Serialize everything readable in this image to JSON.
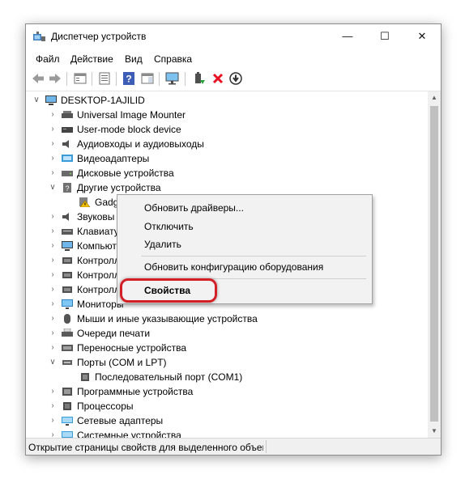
{
  "window": {
    "title": "Диспетчер устройств",
    "minimize": "—",
    "maximize": "☐",
    "close": "✕"
  },
  "menu": [
    "Файл",
    "Действие",
    "Вид",
    "Справка"
  ],
  "tree": {
    "root": "DESKTOP-1AJILID",
    "items": [
      {
        "label": "Universal Image Mounter",
        "expanded": false,
        "icon": "storage-controller-icon"
      },
      {
        "label": "User-mode block device",
        "expanded": false,
        "icon": "block-device-icon"
      },
      {
        "label": "Аудиовходы и аудиовыходы",
        "expanded": false,
        "icon": "speaker-icon"
      },
      {
        "label": "Видеоадаптеры",
        "expanded": false,
        "icon": "display-adapter-icon"
      },
      {
        "label": "Дисковые устройства",
        "expanded": false,
        "icon": "disk-drive-icon"
      },
      {
        "label": "Другие устройства",
        "expanded": true,
        "icon": "unknown-device-icon"
      },
      {
        "label": "Gadg",
        "child": true,
        "icon": "warning-device-icon"
      },
      {
        "label": "Звуковы",
        "expanded": false,
        "icon": "sound-icon"
      },
      {
        "label": "Клавиату",
        "expanded": false,
        "icon": "keyboard-icon"
      },
      {
        "label": "Компьют",
        "expanded": false,
        "icon": "computer-icon"
      },
      {
        "label": "Контролл",
        "expanded": false,
        "icon": "controller-icon"
      },
      {
        "label": "Контролл",
        "expanded": false,
        "icon": "controller-icon"
      },
      {
        "label": "Контролл",
        "expanded": false,
        "icon": "controller-icon"
      },
      {
        "label": "Мониторы",
        "expanded": false,
        "icon": "monitor-icon"
      },
      {
        "label": "Мыши и иные указывающие устройства",
        "expanded": false,
        "icon": "mouse-icon"
      },
      {
        "label": "Очереди печати",
        "expanded": false,
        "icon": "printer-icon"
      },
      {
        "label": "Переносные устройства",
        "expanded": false,
        "icon": "portable-device-icon"
      },
      {
        "label": "Порты (COM и LPT)",
        "expanded": true,
        "icon": "port-icon"
      },
      {
        "label": "Последовательный порт (COM1)",
        "child": true,
        "icon": "serial-port-icon"
      },
      {
        "label": "Программные устройства",
        "expanded": false,
        "icon": "software-device-icon"
      },
      {
        "label": "Процессоры",
        "expanded": false,
        "icon": "processor-icon"
      },
      {
        "label": "Сетевые адаптеры",
        "expanded": false,
        "icon": "network-adapter-icon"
      },
      {
        "label": "Системные устройства",
        "expanded": false,
        "icon": "system-device-icon"
      }
    ]
  },
  "context_menu": {
    "update_drivers": "Обновить драйверы...",
    "disable": "Отключить",
    "uninstall": "Удалить",
    "scan_hardware": "Обновить конфигурацию оборудования",
    "properties": "Свойства"
  },
  "status": "Открытие страницы свойств для выделенного объекта.",
  "colors": {
    "highlight": "#d32027",
    "menu_bg": "#f2f2f2",
    "delete_icon": "#e81123"
  }
}
